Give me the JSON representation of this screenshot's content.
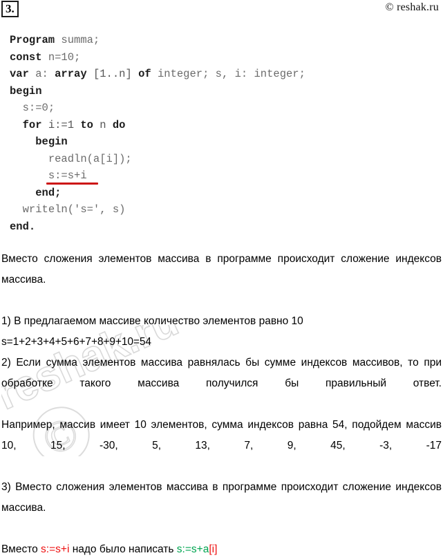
{
  "task": {
    "number_label": "3."
  },
  "watermark": {
    "top_right": "© reshak.ru",
    "ghost_text": "reshak.ru"
  },
  "code": {
    "language": "pascal",
    "highlight_color": "#cc1111",
    "lines": [
      {
        "indent": 0,
        "tokens": [
          {
            "t": "Program ",
            "s": "kw"
          },
          {
            "t": "summa;",
            "s": "id"
          }
        ]
      },
      {
        "indent": 0,
        "tokens": [
          {
            "t": "const ",
            "s": "kw"
          },
          {
            "t": "n=10;",
            "s": "id"
          }
        ]
      },
      {
        "indent": 0,
        "tokens": [
          {
            "t": "var ",
            "s": "kw"
          },
          {
            "t": "a: ",
            "s": "id"
          },
          {
            "t": "array ",
            "s": "kw"
          },
          {
            "t": "[1..n] ",
            "s": "id-d"
          },
          {
            "t": "of ",
            "s": "kw"
          },
          {
            "t": "integer; s, i: integer;",
            "s": "id"
          }
        ]
      },
      {
        "indent": 0,
        "tokens": [
          {
            "t": "begin",
            "s": "kw"
          }
        ]
      },
      {
        "indent": 1,
        "tokens": [
          {
            "t": "s:=0;",
            "s": "id"
          }
        ]
      },
      {
        "indent": 1,
        "tokens": [
          {
            "t": "for ",
            "s": "kw"
          },
          {
            "t": "i:=1 ",
            "s": "id-d"
          },
          {
            "t": "to ",
            "s": "kw"
          },
          {
            "t": "n ",
            "s": "id-d"
          },
          {
            "t": "do",
            "s": "kw"
          }
        ]
      },
      {
        "indent": 2,
        "tokens": [
          {
            "t": "begin",
            "s": "kw"
          }
        ]
      },
      {
        "indent": 3,
        "tokens": [
          {
            "t": "readln(a[i]);",
            "s": "id"
          }
        ]
      },
      {
        "indent": 3,
        "tokens": [
          {
            "t": "s:=s+i",
            "s": "marked"
          }
        ]
      },
      {
        "indent": 2,
        "tokens": [
          {
            "t": "end;",
            "s": "kw"
          }
        ]
      },
      {
        "indent": 1,
        "tokens": [
          {
            "t": "writeln('s=', s)",
            "s": "id"
          }
        ]
      },
      {
        "indent": 0,
        "tokens": [
          {
            "t": "end.",
            "s": "kw"
          }
        ]
      }
    ]
  },
  "prose": {
    "intro": "Вместо сложения элементов массива в программе происходит сложение индексов массива.",
    "item1_title": "1) В предлагаемом массиве количество элементов равно 10",
    "item1_sum": "s=1+2+3+4+5+6+7+8+9+10=54",
    "item2": "2) Если сумма элементов массива равнялась бы сумме индексов массивов, то при обработке такого массива получился бы правильный ответ.",
    "example": "Например, массив имеет 10 элементов, сумма индексов равна 54, подойдем массив 10, 15, -30, 5, 13, 7, 9, 45, -3, -17",
    "item3": "3) Вместо сложения элементов массива в программе происходит сложение индексов массива.",
    "fix_prefix": "Вместо ",
    "fix_wrong": "s:=s+i",
    "fix_middle": " надо было написать ",
    "fix_right_a": "s:=s+a",
    "fix_right_b": "[i]"
  }
}
